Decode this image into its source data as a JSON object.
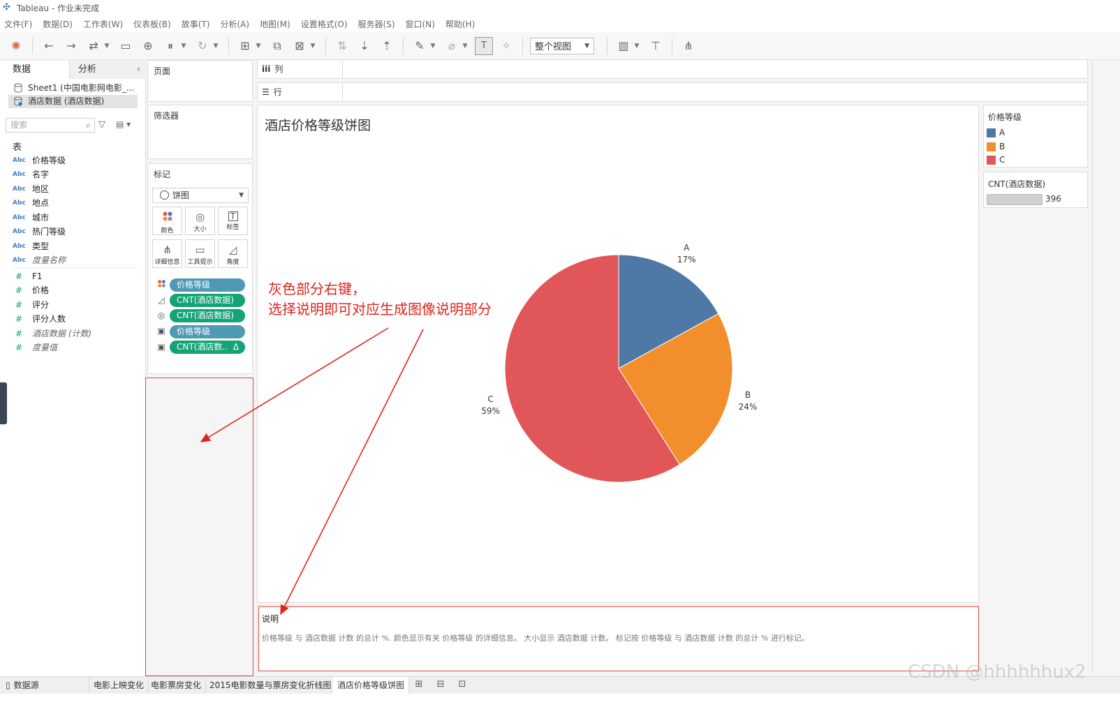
{
  "window": {
    "title": "Tableau - 作业未完成"
  },
  "menu": [
    "文件(F)",
    "数据(D)",
    "工作表(W)",
    "仪表板(B)",
    "故事(T)",
    "分析(A)",
    "地图(M)",
    "设置格式(O)",
    "服务器(S)",
    "窗口(N)",
    "帮助(H)"
  ],
  "toolbar": {
    "view_mode": "整个视图"
  },
  "left_panel": {
    "tab_data": "数据",
    "tab_analysis": "分析",
    "datasources": [
      "Sheet1 (中国电影网电影_...",
      "酒店数据 (酒店数据)"
    ],
    "search_placeholder": "搜索",
    "section_tables": "表",
    "dimensions": [
      "价格等级",
      "名字",
      "地区",
      "地点",
      "城市",
      "热门等级",
      "类型",
      "度量名称"
    ],
    "measures": [
      "F1",
      "价格",
      "评分",
      "评分人数",
      "酒店数据 (计数)",
      "度量值"
    ],
    "abc": "Abc"
  },
  "shelves": {
    "pages": "页面",
    "filters": "筛选器",
    "marks": "标记",
    "columns": "列",
    "rows": "行"
  },
  "marks": {
    "type": "饼图",
    "buttons": [
      "颜色",
      "大小",
      "标签",
      "详细信息",
      "工具提示",
      "角度"
    ],
    "pills": [
      {
        "label": "价格等级",
        "color": "blue"
      },
      {
        "label": "CNT(酒店数据)",
        "color": "green"
      },
      {
        "label": "CNT(酒店数据)",
        "color": "green"
      },
      {
        "label": "价格等级",
        "color": "blue"
      },
      {
        "label": "CNT(酒店数..",
        "color": "green",
        "delta": "Δ"
      }
    ]
  },
  "sheet": {
    "title": "酒店价格等级饼图"
  },
  "chart_data": {
    "type": "pie",
    "title": "酒店价格等级饼图",
    "categories": [
      "A",
      "B",
      "C"
    ],
    "values": [
      17,
      24,
      59
    ],
    "labels": [
      "17%",
      "24%",
      "59%"
    ],
    "colors": [
      "#4e79a7",
      "#f28e2b",
      "#e15759"
    ],
    "total": 396,
    "legend_title": "价格等级",
    "legend_position": "right"
  },
  "annotation": {
    "line1": "灰色部分右键，",
    "line2": "选择说明即可对应生成图像说明部分"
  },
  "caption": {
    "title": "说明",
    "text": "价格等级 与 酒店数据 计数 的总计 %. 颜色显示有关 价格等级 的详细信息。 大小显示 酒店数据 计数。 标记按 价格等级 与 酒店数据 计数 的总计 % 进行标记。"
  },
  "legend": {
    "title": "价格等级",
    "items": [
      {
        "label": "A",
        "color": "#4e79a7"
      },
      {
        "label": "B",
        "color": "#f28e2b"
      },
      {
        "label": "C",
        "color": "#e15759"
      }
    ]
  },
  "size_legend": {
    "title": "CNT(酒店数据)",
    "value": "396"
  },
  "sheet_tabs": [
    "数据源",
    "电影上映变化",
    "电影票房变化",
    "2015电影数量与票房变化折线图",
    "酒店价格等级饼图"
  ],
  "watermark": "CSDN @hhhhhhux2"
}
